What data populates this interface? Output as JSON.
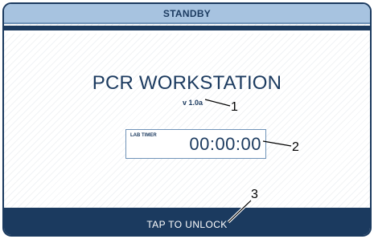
{
  "header": {
    "status": "STANDBY"
  },
  "main": {
    "title": "PCR WORKSTATION",
    "version": "v 1.0a",
    "timer": {
      "label": "LAB TIMER",
      "value": "00:00:00"
    }
  },
  "footer": {
    "unlock_label": "TAP TO UNLOCK"
  },
  "callouts": {
    "c1": "1",
    "c2": "2",
    "c3": "3"
  },
  "colors": {
    "primary": "#1b3a5f",
    "header_bg": "#a7c3e0",
    "border": "#6f93b8"
  }
}
